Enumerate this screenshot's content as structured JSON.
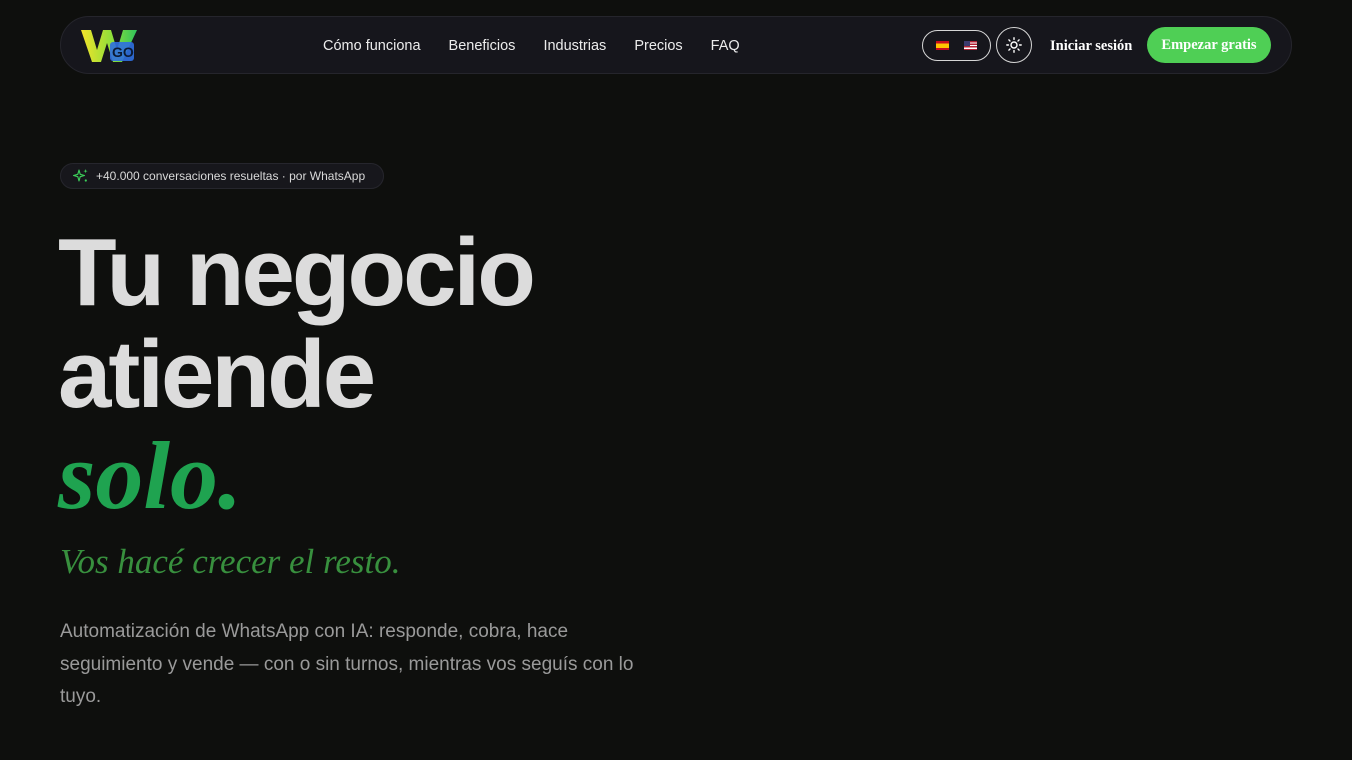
{
  "header": {
    "logo": {
      "icon": "wgo-logo",
      "text": "GO"
    },
    "nav": [
      {
        "label": "Cómo funciona"
      },
      {
        "label": "Beneficios"
      },
      {
        "label": "Industrias"
      },
      {
        "label": "Precios"
      },
      {
        "label": "FAQ"
      }
    ],
    "language": {
      "options": [
        "es",
        "us"
      ],
      "icons": [
        "spain-flag-icon",
        "usa-flag-icon"
      ]
    },
    "theme_toggle": {
      "icon": "sun-icon"
    },
    "login_label": "Iniciar sesión",
    "cta_label": "Empezar gratis"
  },
  "hero": {
    "badge": {
      "icon": "sparkles-icon",
      "text": "+40.000 conversaciones resueltas · por WhatsApp"
    },
    "headline_line1": "Tu negocio",
    "headline_line2": "atiende",
    "headline_accent": "solo.",
    "subheadline": "Vos hacé crecer el resto.",
    "description": "Automatización de WhatsApp con IA: responde, cobra, hace seguimiento y vende — con o sin turnos, mientras vos seguís con lo tuyo."
  },
  "colors": {
    "background": "#0e0f0d",
    "nav_background": "#16161c",
    "cta_green": "#4fcf55",
    "accent_green": "#1fa350",
    "subhead_green": "#38903e",
    "body_text": "#9a9a9a"
  }
}
